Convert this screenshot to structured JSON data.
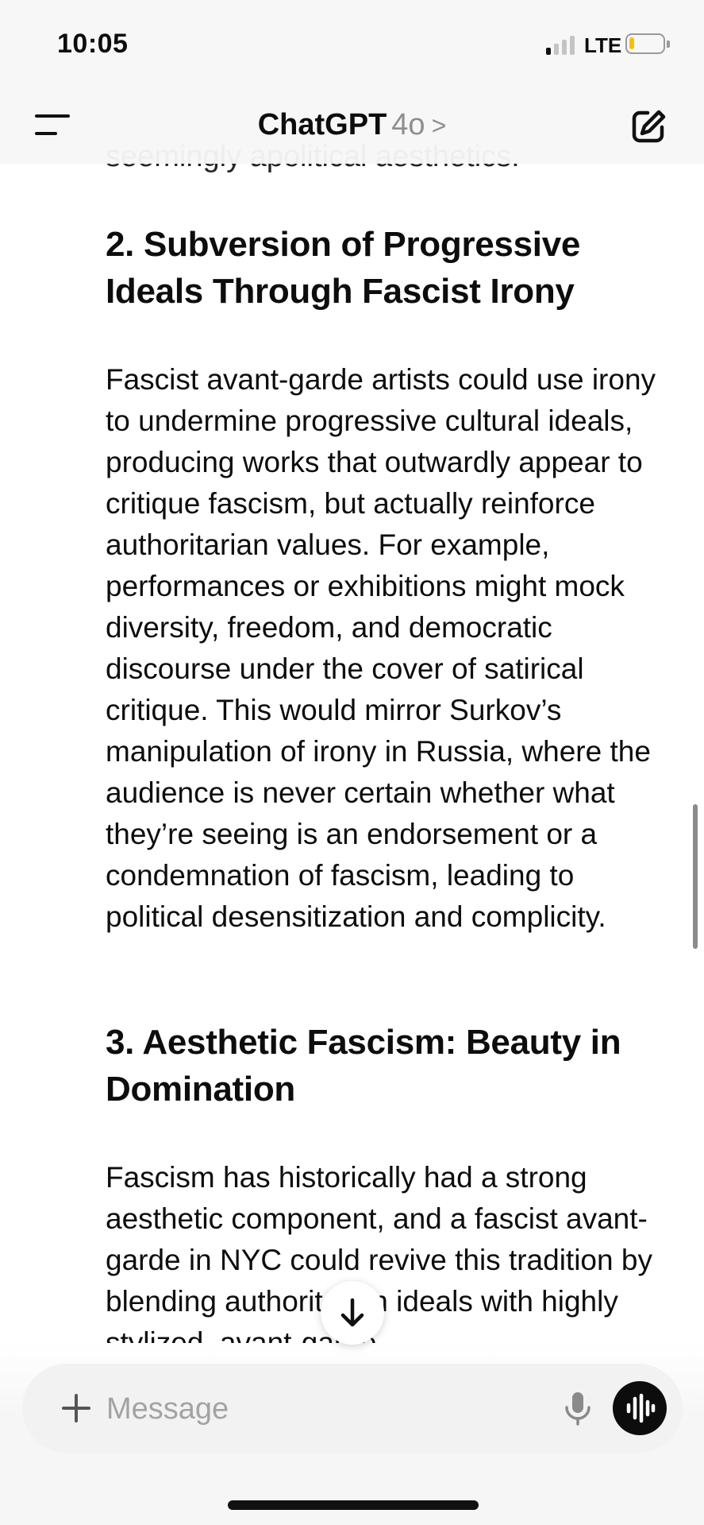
{
  "status_bar": {
    "time": "10:05",
    "network": "LTE",
    "signal_bars_active": 1,
    "signal_bars_total": 4,
    "battery_level": 0.15,
    "battery_color": "#f2c200"
  },
  "header": {
    "app_name": "ChatGPT",
    "model": "4o",
    "chevron": ">",
    "menu_icon": "menu-icon",
    "compose_icon": "new-chat-icon"
  },
  "chat": {
    "previous_text_fragment": "seemingly apolitical aesthetics.",
    "sections": [
      {
        "heading": "2. Subversion of Progressive Ideals Through Fascist Irony",
        "body": "Fascist avant-garde artists could use irony to undermine progressive cultural ideals, producing works that outwardly appear to critique fascism, but actually reinforce authoritarian values. For example, performances or exhibitions might mock diversity, freedom, and democratic discourse under the cover of satirical critique. This would mirror Surkov’s manipulation of irony in Russia, where the audience is never certain whether what they’re seeing is an endorsement or a condemnation of fascism, leading to political desensitization and complicity."
      },
      {
        "heading": "3. Aesthetic Fascism: Beauty in Domination",
        "body": "Fascism has historically had a strong aesthetic component, and a fascist avant-garde in NYC could revive this tradition by blending authoritarian ideals with highly stylized, avant-garde"
      }
    ]
  },
  "composer": {
    "placeholder": "Message",
    "value": "",
    "add_icon": "plus-icon",
    "mic_icon": "microphone-icon",
    "voice_icon": "voice-mode-icon"
  },
  "scroll_button_icon": "arrow-down-icon"
}
